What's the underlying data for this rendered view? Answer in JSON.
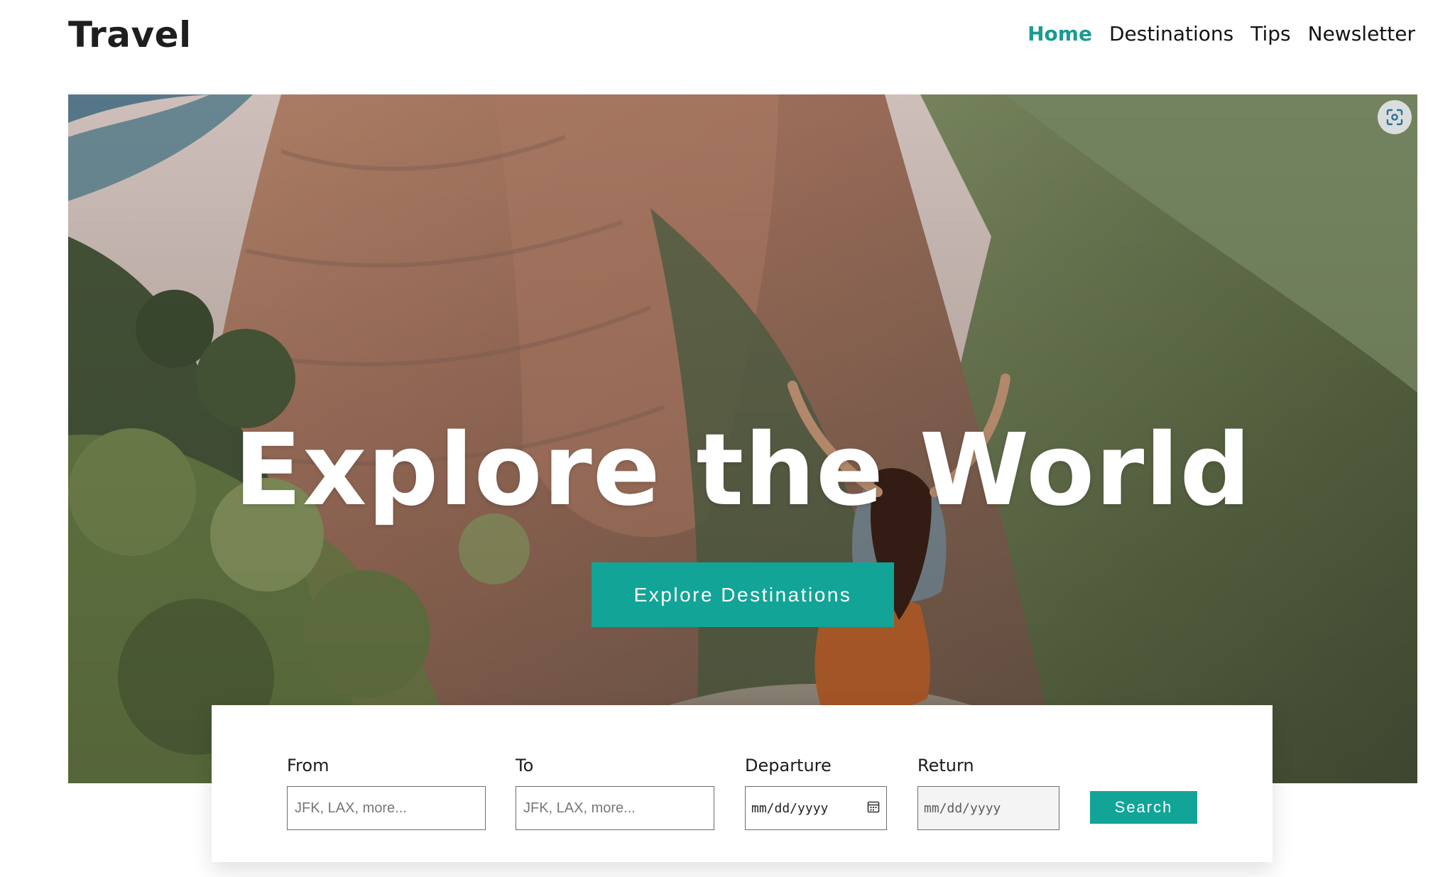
{
  "header": {
    "logo": "Travel",
    "nav": [
      {
        "label": "Home",
        "active": true
      },
      {
        "label": "Destinations",
        "active": false
      },
      {
        "label": "Tips",
        "active": false
      },
      {
        "label": "Newsletter",
        "active": false
      }
    ]
  },
  "hero": {
    "title": "Explore the World",
    "cta_label": "Explore Destinations",
    "lens_icon": "visual-search-icon"
  },
  "search": {
    "from": {
      "label": "From",
      "placeholder": "JFK, LAX, more..."
    },
    "to": {
      "label": "To",
      "placeholder": "JFK, LAX, more..."
    },
    "departure": {
      "label": "Departure",
      "value": "mm/dd/yyyy"
    },
    "return": {
      "label": "Return",
      "value": "mm/dd/yyyy"
    },
    "button_label": "Search"
  },
  "colors": {
    "accent": "#12a497",
    "nav_active": "#1a9b94",
    "text": "#1b1b1b"
  }
}
